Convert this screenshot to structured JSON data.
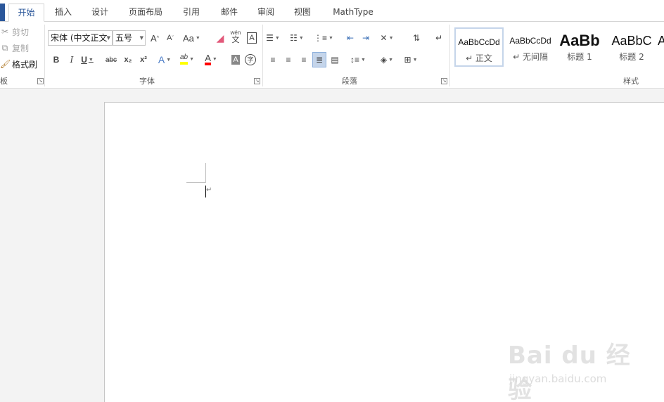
{
  "tabs": [
    {
      "label": "开始"
    },
    {
      "label": "插入"
    },
    {
      "label": "设计"
    },
    {
      "label": "页面布局"
    },
    {
      "label": "引用"
    },
    {
      "label": "邮件"
    },
    {
      "label": "审阅"
    },
    {
      "label": "视图"
    },
    {
      "label": "MathType"
    }
  ],
  "clipboard": {
    "cut": "剪切",
    "copy": "复制",
    "format_painter": "格式刷",
    "group_label": "板"
  },
  "font": {
    "font_name": "宋体 (中文正文",
    "font_size": "五号",
    "grow": "A",
    "shrink": "A",
    "change_case": "Aa",
    "phonetic": "wén",
    "phonetic_sub": "文",
    "char_border": "A",
    "bold": "B",
    "italic": "I",
    "underline": "U",
    "strike": "abc",
    "subscript": "x₂",
    "superscript": "x²",
    "text_effects": "A",
    "highlight": "ab",
    "font_color": "A",
    "char_shading": "A",
    "enclose": "字",
    "group_label": "字体"
  },
  "paragraph": {
    "group_label": "段落"
  },
  "styles": {
    "items": [
      {
        "sample": "AaBbCcDd",
        "name": "↵ 正文"
      },
      {
        "sample": "AaBbCcDd",
        "name": "↵ 无间隔"
      },
      {
        "sample": "AaBb",
        "name": "标题 1"
      },
      {
        "sample": "AaBbC",
        "name": "标题 2"
      },
      {
        "sample": "A",
        "name": ""
      }
    ],
    "group_label": "样式"
  },
  "document": {
    "para_mark": "↵"
  },
  "watermark": {
    "logo": "Bai du 经验",
    "url": "jingyan.baidu.com"
  },
  "colors": {
    "accent": "#2b579a",
    "highlight": "#ffff00",
    "font_color": "#ff0000",
    "selected_bg": "#c5d5ea"
  }
}
